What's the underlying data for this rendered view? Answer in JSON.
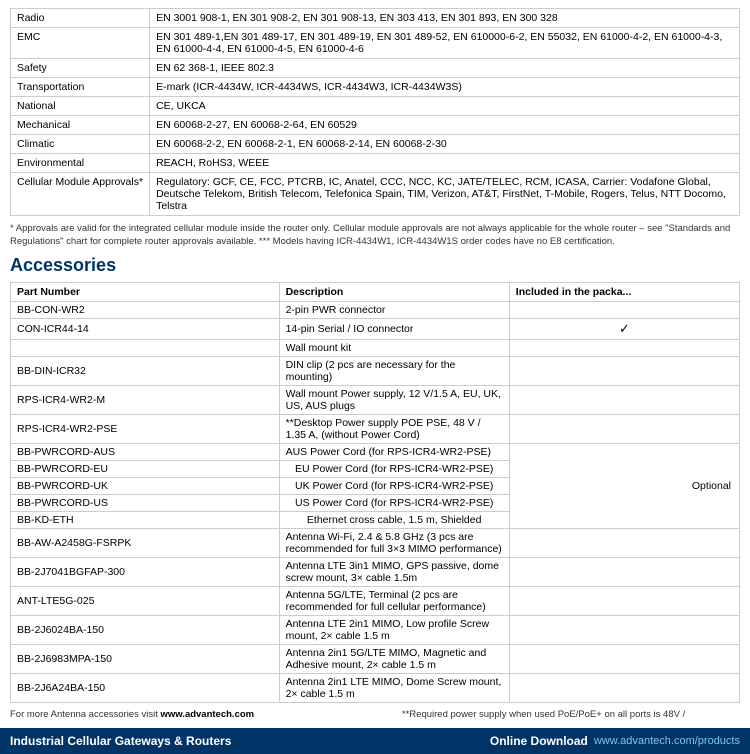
{
  "compliance": {
    "rows": [
      {
        "label": "Radio",
        "value": "EN 3001 908-1, EN 301 908-2, EN 301 908-13, EN 303 413, EN 301 893, EN 300 328"
      },
      {
        "label": "EMC",
        "value": "EN 301 489-1,EN 301 489-17, EN 301 489-19, EN 301 489-52, EN 610000-6-2, EN 55032, EN 61000-4-2, EN 61000-4-3, EN 61000-4-4, EN 61000-4-5, EN 61000-4-6"
      },
      {
        "label": "Safety",
        "value": "EN 62 368-1, IEEE 802.3"
      },
      {
        "label": "Transportation",
        "value": "E-mark (ICR-4434W, ICR-4434WS, ICR-4434W3, ICR-4434W3S)"
      },
      {
        "label": "National",
        "value": "CE, UKCA"
      },
      {
        "label": "Mechanical",
        "value": "EN 60068-2-27, EN 60068-2-64, EN 60529"
      },
      {
        "label": "Climatic",
        "value": "EN 60068-2-2, EN 60068-2-1, EN 60068-2-14, EN 60068-2-30"
      },
      {
        "label": "Environmental",
        "value": "REACH, RoHS3, WEEE"
      },
      {
        "label": "Cellular Module Approvals*",
        "value": "Regulatory: GCF, CE, FCC, PTCRB, IC, Anatel, CCC, NCC, KC, JATE/TELEC, RCM, ICASA, Carrier: Vodafone Global, Deutsche Telekom, British Telecom, Telefonica Spain, TIM, Verizon, AT&T, FirstNet, T-Mobile, Rogers, Telus, NTT Docomo, Telstra"
      }
    ]
  },
  "notes": [
    "* Approvals are valid for the integrated cellular module inside the router only. Cellular module approvals are not always applicable for the whole router – see \"Standards and Regulations\" chart for complete router approvals available. *** Models having ICR-4434W1, ICR-4434W1S order codes have no E8 certification."
  ],
  "accessories": {
    "title": "Accessories",
    "columns": [
      "Part Number",
      "Description",
      "Included in the packa..."
    ],
    "rows": [
      {
        "part": "BB-CON-WR2",
        "description": "2-pin PWR connector",
        "included": ""
      },
      {
        "part": "CON-ICR44-14",
        "description": "14-pin Serial / IO connector",
        "included": "✓"
      },
      {
        "part": "",
        "description": "Wall mount kit",
        "included": ""
      },
      {
        "part": "BB-DIN-ICR32",
        "description": "DIN clip (2 pcs are necessary for the mounting)",
        "included": ""
      },
      {
        "part": "RPS-ICR4-WR2-M",
        "description": "Wall mount Power supply, 12 V/1.5 A, EU, UK, US, AUS plugs",
        "included": ""
      },
      {
        "part": "RPS-ICR4-WR2-PSE",
        "description": "**Desktop Power supply POE PSE, 48 V / 1.35 A, (without Power Cord)",
        "included": ""
      },
      {
        "part": "BB-PWRCORD-AUS",
        "description": "AUS Power Cord (for RPS-ICR4-WR2-PSE)",
        "included": ""
      },
      {
        "part": "BB-PWRCORD-EU",
        "description": "EU Power Cord (for RPS-ICR4-WR2-PSE)",
        "included": ""
      },
      {
        "part": "BB-PWRCORD-UK",
        "description": "UK Power Cord (for RPS-ICR4-WR2-PSE)",
        "included": ""
      },
      {
        "part": "BB-PWRCORD-US",
        "description": "US Power Cord (for RPS-ICR4-WR2-PSE)",
        "included": "Optional"
      },
      {
        "part": "BB-KD-ETH",
        "description": "Ethernet cross cable, 1.5 m, Shielded",
        "included": ""
      },
      {
        "part": "BB-AW-A2458G-FSRPK",
        "description": "Antenna Wi-Fi, 2.4 & 5.8 GHz (3 pcs are recommended for full 3×3 MIMO performance)",
        "included": ""
      },
      {
        "part": "BB-2J7041BGFAP-300",
        "description": "Antenna LTE 3in1 MIMO, GPS passive, dome screw mount, 3× cable 1.5m",
        "included": ""
      },
      {
        "part": "ANT-LTE5G-025",
        "description": "Antenna 5G/LTE, Terminal (2 pcs are recommended for full cellular performance)",
        "included": ""
      },
      {
        "part": "BB-2J6024BA-150",
        "description": "Antenna LTE 2in1 MIMO, Low profile Screw mount, 2× cable 1.5 m",
        "included": ""
      },
      {
        "part": "BB-2J6983MPA-150",
        "description": "Antenna 2in1 5G/LTE MIMO, Magnetic and Adhesive mount, 2× cable 1.5 m",
        "included": ""
      },
      {
        "part": "BB-2J6A24BA-150",
        "description": "Antenna 2in1 LTE MIMO, Dome Screw mount, 2× cable 1.5 m",
        "included": ""
      }
    ]
  },
  "footer": {
    "note_left": "For more Antenna accessories visit",
    "website_left": "www.advantech.com",
    "note_right": "**Required power supply when used PoE/PoE+ on all ports is 48V /",
    "bar": {
      "left": "Industrial Cellular Gateways & Routers",
      "middle": "Online Download",
      "right": "www.advantech.com/products"
    }
  }
}
